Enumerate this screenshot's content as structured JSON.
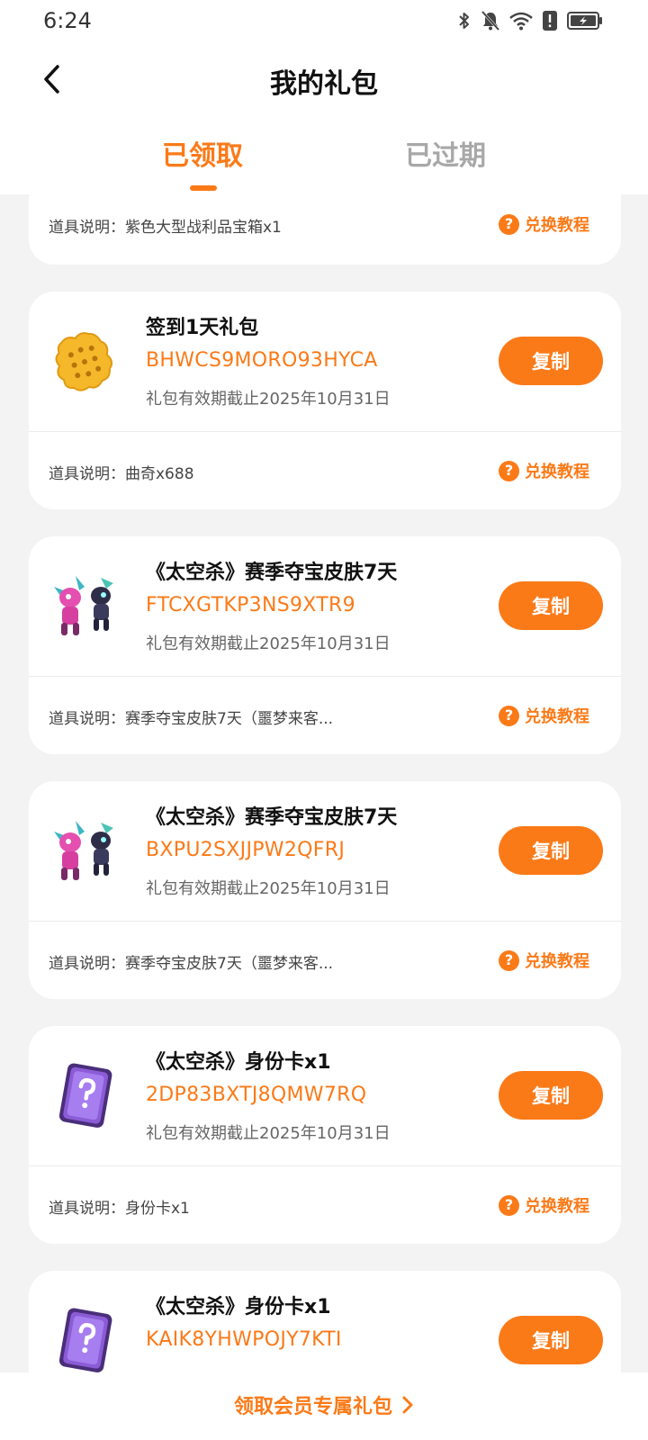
{
  "status_bar": {
    "time": "6:24",
    "icons": [
      "bluetooth-icon",
      "bell-off-icon",
      "wifi-icon",
      "alert-icon",
      "battery-charging-icon"
    ]
  },
  "header": {
    "back_icon": "chevron-left-icon",
    "title": "我的礼包"
  },
  "tabs": [
    {
      "label": "已领取",
      "active": true
    },
    {
      "label": "已过期",
      "active": false
    }
  ],
  "colors": {
    "accent": "#fb7a18",
    "inactive_tab": "#a8a8a8",
    "background": "#f3f3f3",
    "card": "#ffffff"
  },
  "partial_card": {
    "desc_label": "道具说明：",
    "desc_value": "紫色大型战利品宝箱x1",
    "tutorial_label": "兑换教程"
  },
  "cards": [
    {
      "icon": "cookie-icon",
      "title": "签到1天礼包",
      "code": "BHWCS9MORO93HYCA",
      "validity": "礼包有效期截止2025年10月31日",
      "copy_label": "复制",
      "desc_label": "道具说明：",
      "desc_value": "曲奇x688",
      "tutorial_label": "兑换教程"
    },
    {
      "icon": "skin-characters-icon",
      "title": "《太空杀》赛季夺宝皮肤7天",
      "code": "FTCXGTKP3NS9XTR9",
      "validity": "礼包有效期截止2025年10月31日",
      "copy_label": "复制",
      "desc_label": "道具说明：",
      "desc_value": "赛季夺宝皮肤7天（噩梦来客...",
      "tutorial_label": "兑换教程"
    },
    {
      "icon": "skin-characters-icon",
      "title": "《太空杀》赛季夺宝皮肤7天",
      "code": "BXPU2SXJJPW2QFRJ",
      "validity": "礼包有效期截止2025年10月31日",
      "copy_label": "复制",
      "desc_label": "道具说明：",
      "desc_value": "赛季夺宝皮肤7天（噩梦来客...",
      "tutorial_label": "兑换教程"
    },
    {
      "icon": "mystery-card-icon",
      "title": "《太空杀》身份卡x1",
      "code": "2DP83BXTJ8QMW7RQ",
      "validity": "礼包有效期截止2025年10月31日",
      "copy_label": "复制",
      "desc_label": "道具说明：",
      "desc_value": "身份卡x1",
      "tutorial_label": "兑换教程"
    },
    {
      "icon": "mystery-card-icon",
      "title": "《太空杀》身份卡x1",
      "code": "KAIK8YHWPOJY7KTI",
      "copy_label": "复制"
    }
  ],
  "footer": {
    "vip_link": "领取会员专属礼包"
  }
}
